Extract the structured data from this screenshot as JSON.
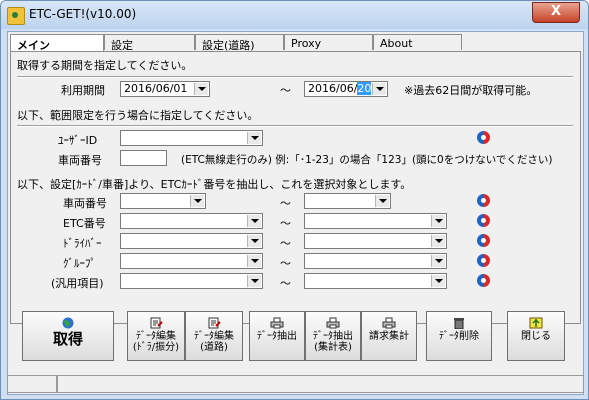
{
  "window": {
    "title": "ETC-GET!(v10.00)",
    "close_glyph": "X"
  },
  "tabs": [
    "メイン",
    "設定",
    "設定(道路)",
    "Proxy",
    "About"
  ],
  "period": {
    "heading": "取得する期間を指定してください。",
    "label": "利用期間",
    "from": "2016/06/01",
    "to_prefix": "2016/06/",
    "to_day": "20",
    "tilde": "～",
    "note": "※過去62日間が取得可能。"
  },
  "filter": {
    "heading": "以下、範囲限定を行う場合に指定してください。",
    "user_id_label": "ﾕｰｻﾞｰID",
    "vehicle_label": "車両番号",
    "vehicle_note": "(ETC無線走行のみ) 例:「･1-23」の場合「123」(頭に0をつけないでください)"
  },
  "extract": {
    "heading": "以下、設定[ｶｰﾄﾞ/車番]より、ETCｶｰﾄﾞ番号を抽出し、これを選択対象とします。",
    "rows": [
      {
        "label": "車両番号"
      },
      {
        "label": "ETC番号"
      },
      {
        "label": "ﾄﾞﾗｲﾊﾞｰ"
      },
      {
        "label": "ｸﾞﾙｰﾌﾟ"
      },
      {
        "label": "(汎用項目)"
      }
    ],
    "tilde": "～"
  },
  "buttons": {
    "get": "取得",
    "edit_driver": [
      "ﾃﾞｰﾀ編集",
      "(ﾄﾞﾗ/振分)"
    ],
    "edit_road": [
      "ﾃﾞｰﾀ編集",
      "(道路)"
    ],
    "extract": "ﾃﾞｰﾀ抽出",
    "extract_summary": [
      "ﾃﾞｰﾀ抽出",
      "(集計表)"
    ],
    "billing": "請求集計",
    "delete": "ﾃﾞｰﾀ削除",
    "close": "閉じる"
  },
  "colors": {
    "highlight": "#3399ff",
    "title_bar": "#cfe0f3",
    "close": "#c7432a"
  },
  "icons": [
    "app-icon",
    "refresh-icon",
    "globe-icon",
    "printer-icon",
    "trash-icon",
    "exit-icon"
  ]
}
